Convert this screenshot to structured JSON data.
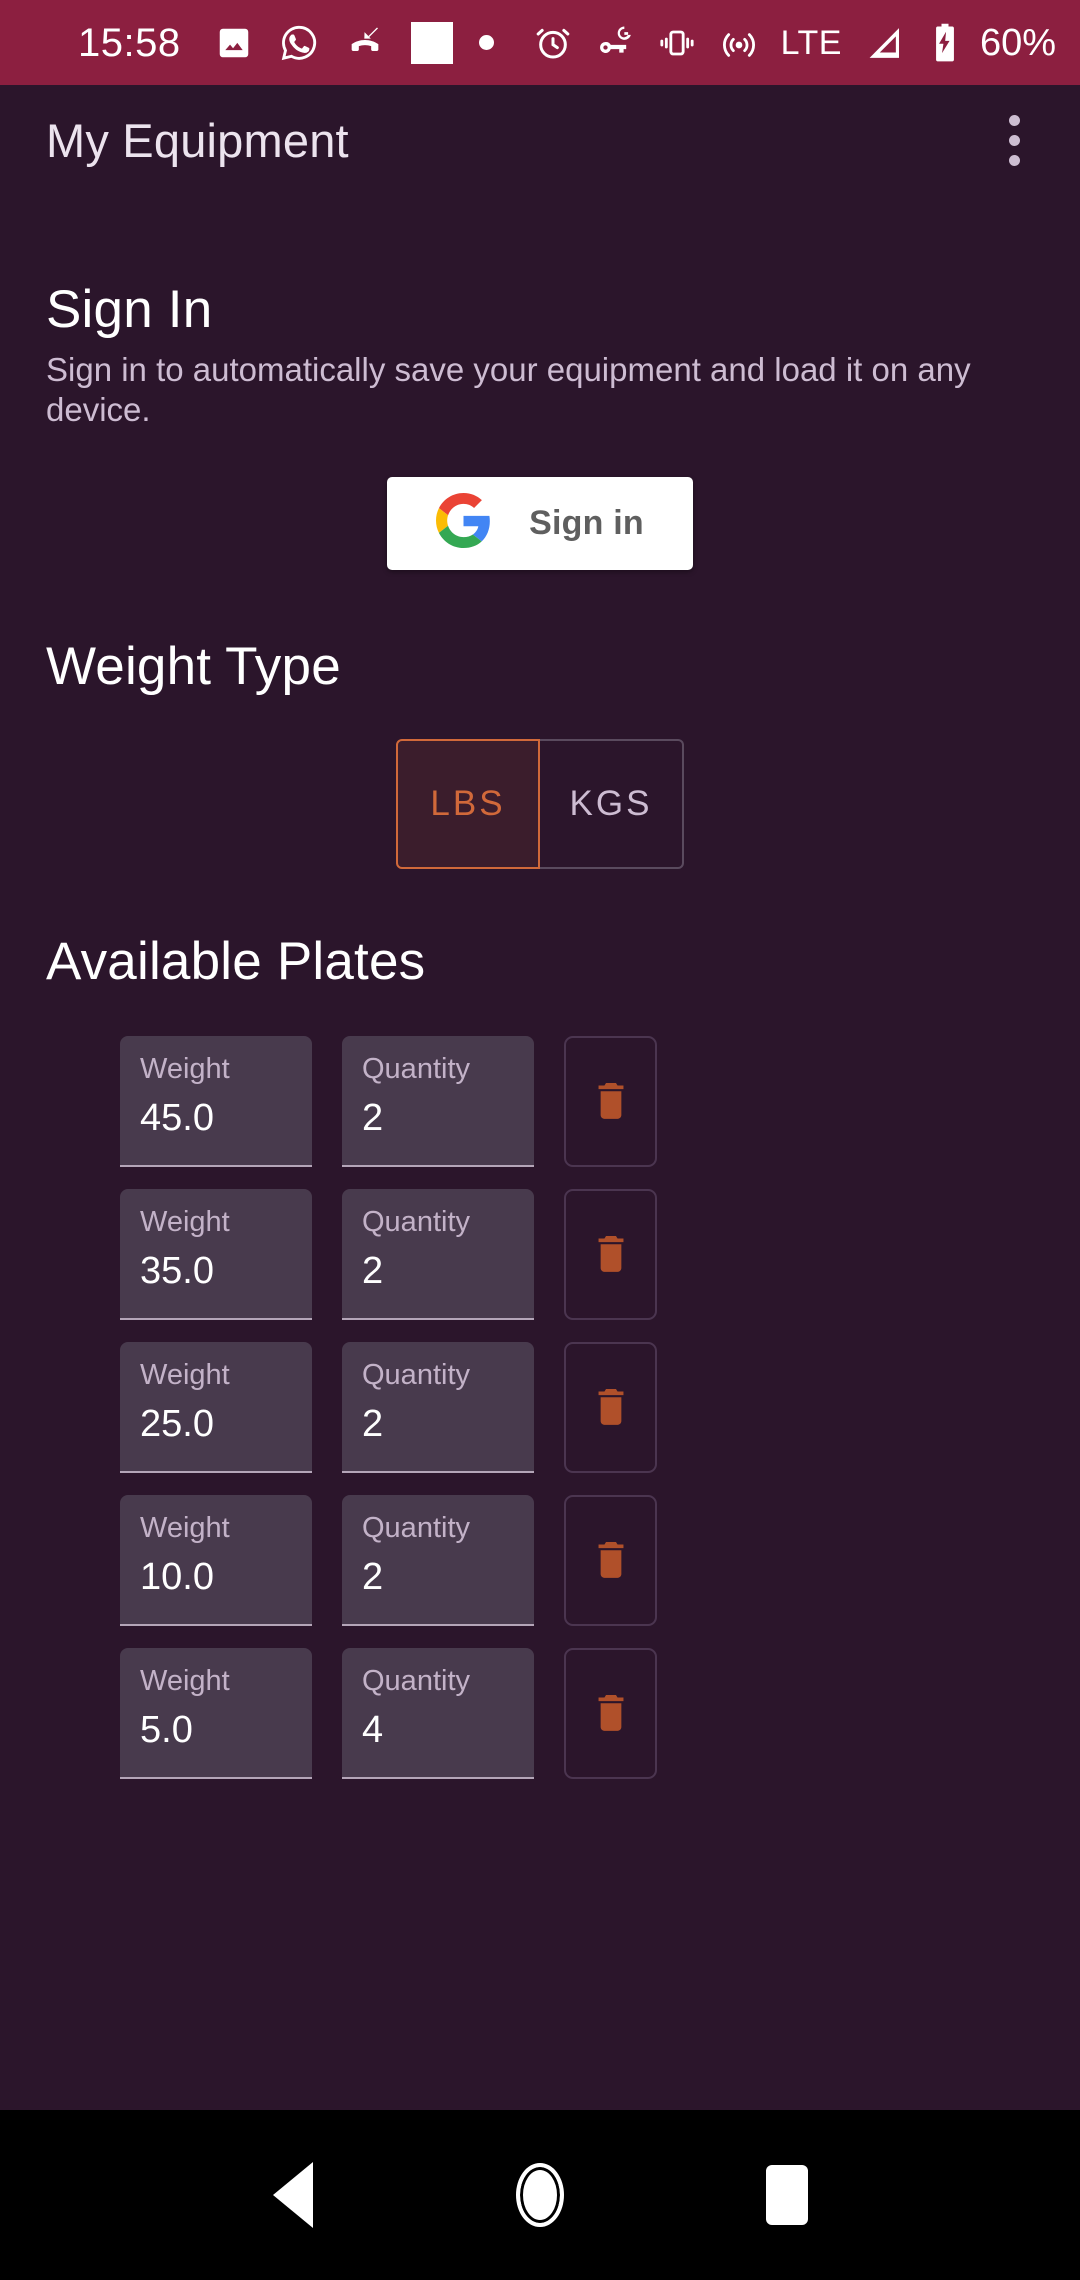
{
  "status_bar": {
    "time": "15:58",
    "battery_percent": "60%",
    "network_type": "LTE",
    "left_icons": [
      "photo-icon",
      "whatsapp-icon",
      "missed-call-icon",
      "white-square-icon",
      "dot-icon"
    ],
    "right_icons": [
      "alarm-icon",
      "vpn-key-icon",
      "vibrate-icon",
      "hotspot-icon",
      "signal-icon",
      "battery-charging-icon"
    ],
    "background_color": "#8c1f40"
  },
  "app_bar": {
    "title": "My Equipment",
    "overflow_menu": "overflow-menu-icon"
  },
  "sign_in": {
    "heading": "Sign In",
    "description": "Sign in to automatically save your equipment and load it on any device.",
    "button_label": "Sign in",
    "button_icon": "google-g-icon"
  },
  "weight_type": {
    "heading": "Weight Type",
    "options": [
      {
        "label": "LBS",
        "selected": true
      },
      {
        "label": "KGS",
        "selected": false
      }
    ],
    "selected_color": "#d1693a"
  },
  "plates": {
    "heading": "Available Plates",
    "weight_label": "Weight",
    "quantity_label": "Quantity",
    "delete_icon": "trash-icon",
    "delete_icon_color": "#b0502a",
    "rows": [
      {
        "weight": "45.0",
        "quantity": "2"
      },
      {
        "weight": "35.0",
        "quantity": "2"
      },
      {
        "weight": "25.0",
        "quantity": "2"
      },
      {
        "weight": "10.0",
        "quantity": "2"
      },
      {
        "weight": "5.0",
        "quantity": "4"
      }
    ]
  },
  "nav_bar": {
    "back": "back-triangle-icon",
    "home": "home-circle-icon",
    "recents": "recents-square-icon"
  },
  "theme": {
    "background": "#2b152b",
    "field_background": "#483a4d",
    "accent": "#d1693a",
    "text_primary": "#ffffff",
    "text_secondary": "#cdbcd2"
  }
}
